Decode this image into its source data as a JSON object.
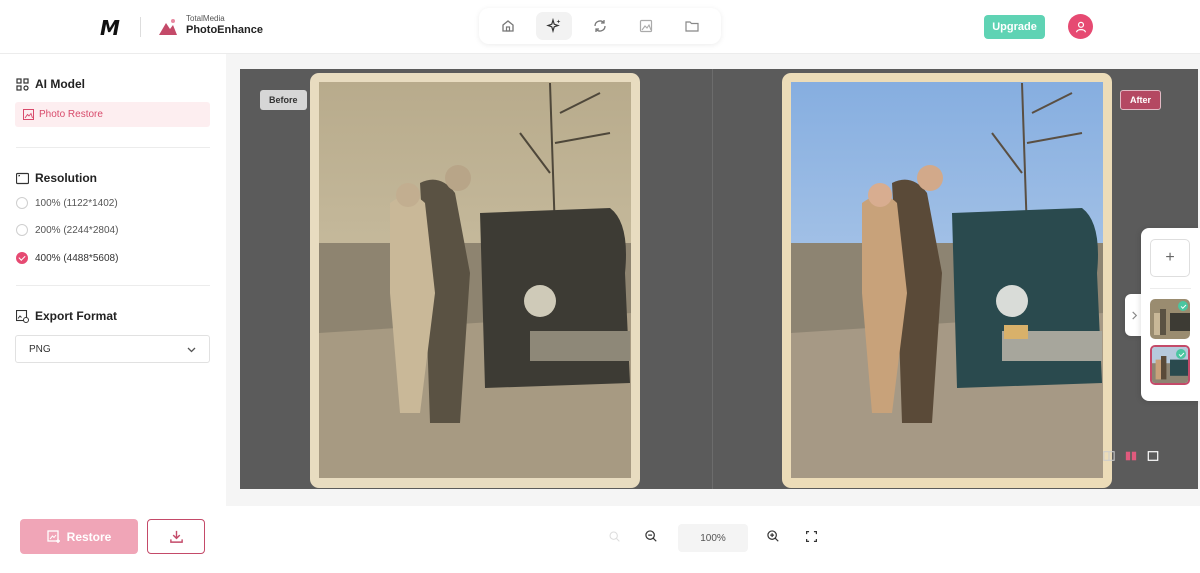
{
  "header": {
    "logo_mark": "M",
    "brand_small": "TotalMedia",
    "brand_name": "PhotoEnhance",
    "nav_items": [
      "home-icon",
      "sparkle-icon",
      "refresh-icon",
      "image-icon",
      "folder-icon"
    ],
    "upgrade_label": "Upgrade",
    "avatar_icon": "user-icon"
  },
  "sidebar": {
    "ai_model_title": "AI Model",
    "model_option": "Photo Restore",
    "resolution_title": "Resolution",
    "resolutions": [
      {
        "label": "100% (1122*1402)",
        "checked": false
      },
      {
        "label": "200% (2244*2804)",
        "checked": false
      },
      {
        "label": "400% (4488*5608)",
        "checked": true
      }
    ],
    "export_title": "Export Format",
    "export_value": "PNG"
  },
  "canvas": {
    "before_label": "Before",
    "after_label": "After",
    "view_modes": [
      "split-view-icon",
      "side-by-side-icon",
      "single-view-icon"
    ]
  },
  "thumbs": {
    "add_label": "+"
  },
  "bottom": {
    "restore_label": "Restore",
    "zoom_value": "100%"
  },
  "colors": {
    "accent": "#e64a72",
    "upgrade": "#5fd3b4",
    "restore_disabled": "#f0a5b7",
    "stage": "#5b5b5b"
  }
}
